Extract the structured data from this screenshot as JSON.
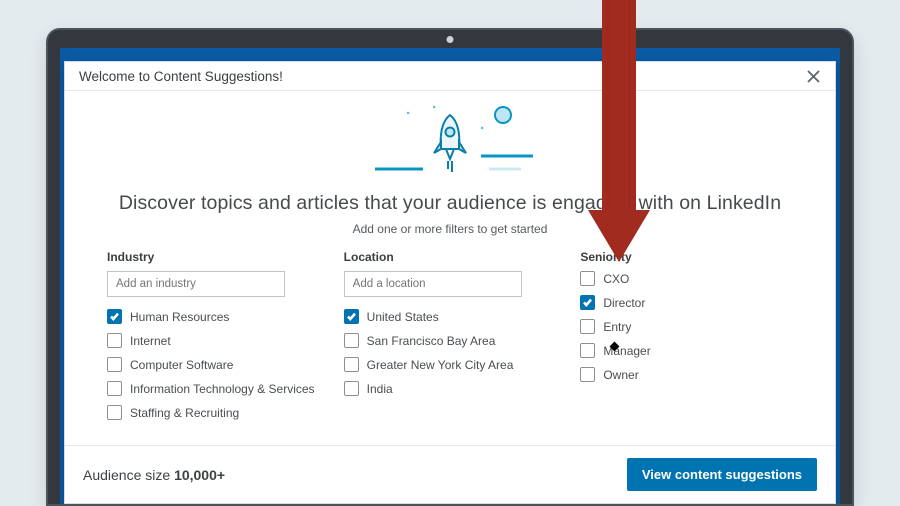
{
  "dialog": {
    "title": "Welcome to Content Suggestions!",
    "headline": "Discover topics and articles that your audience is engaging with on LinkedIn",
    "subhead": "Add one or more filters to get started"
  },
  "columns": {
    "industry": {
      "title": "Industry",
      "placeholder": "Add an industry",
      "items": [
        {
          "label": "Human Resources",
          "checked": true
        },
        {
          "label": "Internet",
          "checked": false
        },
        {
          "label": "Computer Software",
          "checked": false
        },
        {
          "label": "Information Technology & Services",
          "checked": false
        },
        {
          "label": "Staffing & Recruiting",
          "checked": false
        }
      ]
    },
    "location": {
      "title": "Location",
      "placeholder": "Add a location",
      "items": [
        {
          "label": "United States",
          "checked": true
        },
        {
          "label": "San Francisco Bay Area",
          "checked": false
        },
        {
          "label": "Greater New York City Area",
          "checked": false
        },
        {
          "label": "India",
          "checked": false
        }
      ]
    },
    "seniority": {
      "title": "Seniority",
      "items": [
        {
          "label": "CXO",
          "checked": false
        },
        {
          "label": "Director",
          "checked": true
        },
        {
          "label": "Entry",
          "checked": false
        },
        {
          "label": "Manager",
          "checked": false
        },
        {
          "label": "Owner",
          "checked": false
        }
      ]
    }
  },
  "footer": {
    "audience_label": "Audience size ",
    "audience_value": "10,000+",
    "cta": "View content suggestions"
  },
  "colors": {
    "primary": "#0073b1",
    "arrow": "#a6261a"
  }
}
